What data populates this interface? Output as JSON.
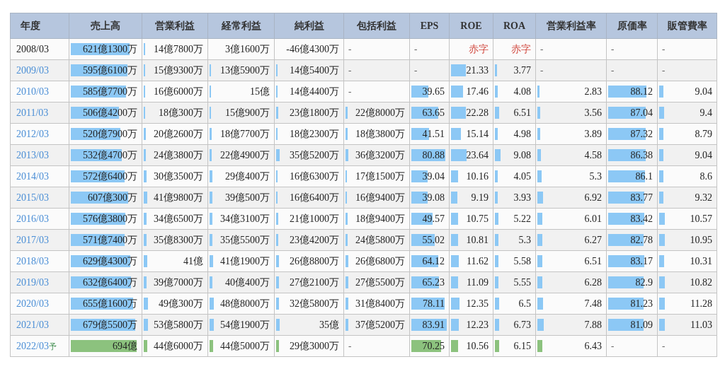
{
  "table": {
    "columns": [
      "年度",
      "売上高",
      "営業利益",
      "経常利益",
      "純利益",
      "包括利益",
      "EPS",
      "ROE",
      "ROA",
      "営業利益率",
      "原価率",
      "販管費率"
    ],
    "rows": [
      {
        "forecast": false,
        "cells": [
          {
            "kind": "year",
            "text": "2008/03",
            "linked": false
          },
          {
            "kind": "value",
            "text": "621億1300万",
            "level": 0.85
          },
          {
            "kind": "value",
            "text": "14億7800万",
            "level": 0.02
          },
          {
            "kind": "value",
            "text": "3億1600万"
          },
          {
            "kind": "value",
            "text": "-46億4300万"
          },
          {
            "kind": "dash",
            "text": "-"
          },
          {
            "kind": "dash",
            "text": "-"
          },
          {
            "kind": "loss",
            "text": "赤字"
          },
          {
            "kind": "loss",
            "text": "赤字"
          },
          {
            "kind": "dash",
            "text": "-"
          },
          {
            "kind": "dash",
            "text": "-"
          },
          {
            "kind": "dash",
            "text": "-"
          }
        ]
      },
      {
        "forecast": false,
        "cells": [
          {
            "kind": "year",
            "text": "2009/03",
            "linked": true
          },
          {
            "kind": "value",
            "text": "595億6100万",
            "level": 0.82
          },
          {
            "kind": "value",
            "text": "15億9300万",
            "level": 0.02
          },
          {
            "kind": "value",
            "text": "13億5900万",
            "level": 0.02
          },
          {
            "kind": "value",
            "text": "14億5400万",
            "level": 0.02
          },
          {
            "kind": "dash",
            "text": "-"
          },
          {
            "kind": "dash",
            "text": "-"
          },
          {
            "kind": "value",
            "text": "21.33",
            "level": 0.36
          },
          {
            "kind": "value",
            "text": "3.77",
            "level": 0.06
          },
          {
            "kind": "dash",
            "text": "-"
          },
          {
            "kind": "dash",
            "text": "-"
          },
          {
            "kind": "dash",
            "text": "-"
          }
        ]
      },
      {
        "forecast": false,
        "cells": [
          {
            "kind": "year",
            "text": "2010/03",
            "linked": true
          },
          {
            "kind": "value",
            "text": "585億7700万",
            "level": 0.8
          },
          {
            "kind": "value",
            "text": "16億6000万",
            "level": 0.02
          },
          {
            "kind": "value",
            "text": "15億",
            "level": 0.02
          },
          {
            "kind": "value",
            "text": "14億4400万",
            "level": 0.02
          },
          {
            "kind": "dash",
            "text": "-"
          },
          {
            "kind": "value",
            "text": "39.65",
            "level": 0.47
          },
          {
            "kind": "value",
            "text": "17.46",
            "level": 0.29
          },
          {
            "kind": "value",
            "text": "4.08",
            "level": 0.07
          },
          {
            "kind": "value",
            "text": "2.83",
            "level": 0.03
          },
          {
            "kind": "value",
            "text": "88.12",
            "level": 0.8
          },
          {
            "kind": "value",
            "text": "9.04",
            "level": 0.08
          }
        ]
      },
      {
        "forecast": false,
        "cells": [
          {
            "kind": "year",
            "text": "2011/03",
            "linked": true
          },
          {
            "kind": "value",
            "text": "506億4200万",
            "level": 0.69
          },
          {
            "kind": "value",
            "text": "18億300万",
            "level": 0.02
          },
          {
            "kind": "value",
            "text": "15億900万",
            "level": 0.02
          },
          {
            "kind": "value",
            "text": "23億1800万",
            "level": 0.03
          },
          {
            "kind": "value",
            "text": "22億8000万",
            "level": 0.03
          },
          {
            "kind": "value",
            "text": "63.65",
            "level": 0.75
          },
          {
            "kind": "value",
            "text": "22.28",
            "level": 0.37
          },
          {
            "kind": "value",
            "text": "6.51",
            "level": 0.11
          },
          {
            "kind": "value",
            "text": "3.56",
            "level": 0.04
          },
          {
            "kind": "value",
            "text": "87.04",
            "level": 0.79
          },
          {
            "kind": "value",
            "text": "9.4",
            "level": 0.09
          }
        ]
      },
      {
        "forecast": false,
        "cells": [
          {
            "kind": "year",
            "text": "2012/03",
            "linked": true
          },
          {
            "kind": "value",
            "text": "520億7900万",
            "level": 0.71
          },
          {
            "kind": "value",
            "text": "20億2600万",
            "level": 0.03
          },
          {
            "kind": "value",
            "text": "18億7700万",
            "level": 0.03
          },
          {
            "kind": "value",
            "text": "18億2300万",
            "level": 0.02
          },
          {
            "kind": "value",
            "text": "18億3800万",
            "level": 0.03
          },
          {
            "kind": "value",
            "text": "41.51",
            "level": 0.49
          },
          {
            "kind": "value",
            "text": "15.14",
            "level": 0.25
          },
          {
            "kind": "value",
            "text": "4.98",
            "level": 0.08
          },
          {
            "kind": "value",
            "text": "3.89",
            "level": 0.04
          },
          {
            "kind": "value",
            "text": "87.32",
            "level": 0.79
          },
          {
            "kind": "value",
            "text": "8.79",
            "level": 0.08
          }
        ]
      },
      {
        "forecast": false,
        "cells": [
          {
            "kind": "year",
            "text": "2013/03",
            "linked": true
          },
          {
            "kind": "value",
            "text": "532億4700万",
            "level": 0.73
          },
          {
            "kind": "value",
            "text": "24億3800万",
            "level": 0.03
          },
          {
            "kind": "value",
            "text": "22億4900万",
            "level": 0.03
          },
          {
            "kind": "value",
            "text": "35億5200万",
            "level": 0.05
          },
          {
            "kind": "value",
            "text": "36億3200万",
            "level": 0.05
          },
          {
            "kind": "value",
            "text": "80.88",
            "level": 0.95
          },
          {
            "kind": "value",
            "text": "23.64",
            "level": 0.39
          },
          {
            "kind": "value",
            "text": "9.08",
            "level": 0.15
          },
          {
            "kind": "value",
            "text": "4.58",
            "level": 0.05
          },
          {
            "kind": "value",
            "text": "86.38",
            "level": 0.79
          },
          {
            "kind": "value",
            "text": "9.04",
            "level": 0.08
          }
        ]
      },
      {
        "forecast": false,
        "cells": [
          {
            "kind": "year",
            "text": "2014/03",
            "linked": true
          },
          {
            "kind": "value",
            "text": "572億6400万",
            "level": 0.78
          },
          {
            "kind": "value",
            "text": "30億3500万",
            "level": 0.04
          },
          {
            "kind": "value",
            "text": "29億400万",
            "level": 0.04
          },
          {
            "kind": "value",
            "text": "16億6300万",
            "level": 0.02
          },
          {
            "kind": "value",
            "text": "17億1500万",
            "level": 0.02
          },
          {
            "kind": "value",
            "text": "39.04",
            "level": 0.46
          },
          {
            "kind": "value",
            "text": "10.16",
            "level": 0.17
          },
          {
            "kind": "value",
            "text": "4.05",
            "level": 0.07
          },
          {
            "kind": "value",
            "text": "5.3",
            "level": 0.06
          },
          {
            "kind": "value",
            "text": "86.1",
            "level": 0.78
          },
          {
            "kind": "value",
            "text": "8.6",
            "level": 0.08
          }
        ]
      },
      {
        "forecast": false,
        "cells": [
          {
            "kind": "year",
            "text": "2015/03",
            "linked": true
          },
          {
            "kind": "value",
            "text": "607億300万",
            "level": 0.83
          },
          {
            "kind": "value",
            "text": "41億9800万",
            "level": 0.06
          },
          {
            "kind": "value",
            "text": "39億500万",
            "level": 0.05
          },
          {
            "kind": "value",
            "text": "16億6400万",
            "level": 0.02
          },
          {
            "kind": "value",
            "text": "16億9400万",
            "level": 0.02
          },
          {
            "kind": "value",
            "text": "39.08",
            "level": 0.46
          },
          {
            "kind": "value",
            "text": "9.19",
            "level": 0.15
          },
          {
            "kind": "value",
            "text": "3.93",
            "level": 0.07
          },
          {
            "kind": "value",
            "text": "6.92",
            "level": 0.08
          },
          {
            "kind": "value",
            "text": "83.77",
            "level": 0.76
          },
          {
            "kind": "value",
            "text": "9.32",
            "level": 0.08
          }
        ]
      },
      {
        "forecast": false,
        "cells": [
          {
            "kind": "year",
            "text": "2016/03",
            "linked": true
          },
          {
            "kind": "value",
            "text": "576億3800万",
            "level": 0.79
          },
          {
            "kind": "value",
            "text": "34億6500万",
            "level": 0.05
          },
          {
            "kind": "value",
            "text": "34億3100万",
            "level": 0.05
          },
          {
            "kind": "value",
            "text": "21億1000万",
            "level": 0.03
          },
          {
            "kind": "value",
            "text": "18億9400万",
            "level": 0.03
          },
          {
            "kind": "value",
            "text": "49.57",
            "level": 0.58
          },
          {
            "kind": "value",
            "text": "10.75",
            "level": 0.18
          },
          {
            "kind": "value",
            "text": "5.22",
            "level": 0.09
          },
          {
            "kind": "value",
            "text": "6.01",
            "level": 0.07
          },
          {
            "kind": "value",
            "text": "83.42",
            "level": 0.76
          },
          {
            "kind": "value",
            "text": "10.57",
            "level": 0.1
          }
        ]
      },
      {
        "forecast": false,
        "cells": [
          {
            "kind": "year",
            "text": "2017/03",
            "linked": true
          },
          {
            "kind": "value",
            "text": "571億7400万",
            "level": 0.78
          },
          {
            "kind": "value",
            "text": "35億8300万",
            "level": 0.05
          },
          {
            "kind": "value",
            "text": "35億5500万",
            "level": 0.05
          },
          {
            "kind": "value",
            "text": "23億4200万",
            "level": 0.03
          },
          {
            "kind": "value",
            "text": "24億5800万",
            "level": 0.03
          },
          {
            "kind": "value",
            "text": "55.02",
            "level": 0.65
          },
          {
            "kind": "value",
            "text": "10.81",
            "level": 0.18
          },
          {
            "kind": "value",
            "text": "5.3",
            "level": 0.09
          },
          {
            "kind": "value",
            "text": "6.27",
            "level": 0.07
          },
          {
            "kind": "value",
            "text": "82.78",
            "level": 0.75
          },
          {
            "kind": "value",
            "text": "10.95",
            "level": 0.1
          }
        ]
      },
      {
        "forecast": false,
        "cells": [
          {
            "kind": "year",
            "text": "2018/03",
            "linked": true
          },
          {
            "kind": "value",
            "text": "629億4300万",
            "level": 0.86
          },
          {
            "kind": "value",
            "text": "41億",
            "level": 0.06
          },
          {
            "kind": "value",
            "text": "41億1900万",
            "level": 0.06
          },
          {
            "kind": "value",
            "text": "26億8800万",
            "level": 0.04
          },
          {
            "kind": "value",
            "text": "26億6800万",
            "level": 0.04
          },
          {
            "kind": "value",
            "text": "64.12",
            "level": 0.75
          },
          {
            "kind": "value",
            "text": "11.62",
            "level": 0.19
          },
          {
            "kind": "value",
            "text": "5.58",
            "level": 0.09
          },
          {
            "kind": "value",
            "text": "6.51",
            "level": 0.07
          },
          {
            "kind": "value",
            "text": "83.17",
            "level": 0.76
          },
          {
            "kind": "value",
            "text": "10.31",
            "level": 0.09
          }
        ]
      },
      {
        "forecast": false,
        "cells": [
          {
            "kind": "year",
            "text": "2019/03",
            "linked": true
          },
          {
            "kind": "value",
            "text": "632億6400万",
            "level": 0.87
          },
          {
            "kind": "value",
            "text": "39億7000万",
            "level": 0.05
          },
          {
            "kind": "value",
            "text": "40億400万",
            "level": 0.05
          },
          {
            "kind": "value",
            "text": "27億2100万",
            "level": 0.04
          },
          {
            "kind": "value",
            "text": "27億5500万",
            "level": 0.04
          },
          {
            "kind": "value",
            "text": "65.23",
            "level": 0.77
          },
          {
            "kind": "value",
            "text": "11.09",
            "level": 0.18
          },
          {
            "kind": "value",
            "text": "5.55",
            "level": 0.09
          },
          {
            "kind": "value",
            "text": "6.28",
            "level": 0.07
          },
          {
            "kind": "value",
            "text": "82.9",
            "level": 0.75
          },
          {
            "kind": "value",
            "text": "10.82",
            "level": 0.1
          }
        ]
      },
      {
        "forecast": false,
        "cells": [
          {
            "kind": "year",
            "text": "2020/03",
            "linked": true
          },
          {
            "kind": "value",
            "text": "655億1600万",
            "level": 0.9
          },
          {
            "kind": "value",
            "text": "49億300万",
            "level": 0.07
          },
          {
            "kind": "value",
            "text": "48億8000万",
            "level": 0.07
          },
          {
            "kind": "value",
            "text": "32億5800万",
            "level": 0.04
          },
          {
            "kind": "value",
            "text": "31億8400万",
            "level": 0.04
          },
          {
            "kind": "value",
            "text": "78.11",
            "level": 0.92
          },
          {
            "kind": "value",
            "text": "12.35",
            "level": 0.21
          },
          {
            "kind": "value",
            "text": "6.5",
            "level": 0.11
          },
          {
            "kind": "value",
            "text": "7.48",
            "level": 0.08
          },
          {
            "kind": "value",
            "text": "81.23",
            "level": 0.74
          },
          {
            "kind": "value",
            "text": "11.28",
            "level": 0.1
          }
        ]
      },
      {
        "forecast": false,
        "cells": [
          {
            "kind": "year",
            "text": "2021/03",
            "linked": true
          },
          {
            "kind": "value",
            "text": "679億5500万",
            "level": 0.93
          },
          {
            "kind": "value",
            "text": "53億5800万",
            "level": 0.07
          },
          {
            "kind": "value",
            "text": "54億1900万",
            "level": 0.07
          },
          {
            "kind": "value",
            "text": "35億",
            "level": 0.05
          },
          {
            "kind": "value",
            "text": "37億5200万",
            "level": 0.05
          },
          {
            "kind": "value",
            "text": "83.91",
            "level": 0.99
          },
          {
            "kind": "value",
            "text": "12.23",
            "level": 0.2
          },
          {
            "kind": "value",
            "text": "6.73",
            "level": 0.11
          },
          {
            "kind": "value",
            "text": "7.88",
            "level": 0.09
          },
          {
            "kind": "value",
            "text": "81.09",
            "level": 0.74
          },
          {
            "kind": "value",
            "text": "11.03",
            "level": 0.1
          }
        ]
      },
      {
        "forecast": true,
        "cells": [
          {
            "kind": "year",
            "text": "2022/03",
            "linked": true,
            "mark": "予"
          },
          {
            "kind": "value",
            "text": "694億",
            "level": 0.95
          },
          {
            "kind": "value",
            "text": "44億6000万",
            "level": 0.06
          },
          {
            "kind": "value",
            "text": "44億5000万",
            "level": 0.06
          },
          {
            "kind": "value",
            "text": "29億3000万",
            "level": 0.04
          },
          {
            "kind": "dash",
            "text": "-"
          },
          {
            "kind": "value",
            "text": "70.25",
            "level": 0.83
          },
          {
            "kind": "value",
            "text": "10.56",
            "level": 0.18
          },
          {
            "kind": "value",
            "text": "6.15",
            "level": 0.1
          },
          {
            "kind": "value",
            "text": "6.43",
            "level": 0.07
          },
          {
            "kind": "dash",
            "text": "-"
          },
          {
            "kind": "dash",
            "text": "-"
          }
        ]
      }
    ]
  }
}
